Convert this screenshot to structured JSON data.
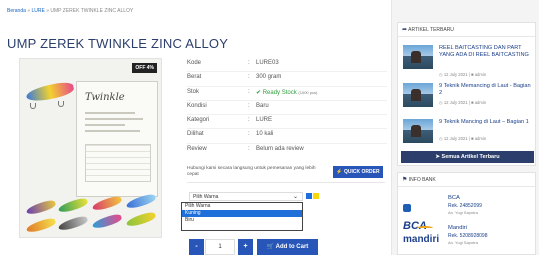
{
  "breadcrumb": {
    "home": "Beranda",
    "sep": " » ",
    "category": "LURE",
    "current": "UMP ZEREK TWINKLE ZINC ALLOY"
  },
  "product": {
    "title": "UMP ZEREK TWINKLE ZINC ALLOY",
    "badge": "OFF 4%",
    "package_title": "Twinkle",
    "specs": [
      {
        "key": "Kode",
        "value": "LURE03"
      },
      {
        "key": "Berat",
        "value": "300 gram"
      },
      {
        "key": "Stok",
        "value": "Ready Stock",
        "note": "(1000 pcs)"
      },
      {
        "key": "Kondisi",
        "value": "Baru"
      },
      {
        "key": "Kategori",
        "value": "LURE"
      },
      {
        "key": "Dilihat",
        "value": "10 kali"
      },
      {
        "key": "Review",
        "value": "Belum ada review"
      }
    ],
    "colon": ":",
    "help_text": "Hubungi kami secara langsung untuk pemesanan yang lebih cepat",
    "quick_order_label": "QUICK ORDER",
    "color_select": {
      "selected": "Pilih Warna",
      "options": [
        "Pilih Warna",
        "Kuning",
        "Biru"
      ],
      "highlighted_index": 1
    },
    "swatches": [
      "#1e6fd9",
      "#f5d90a"
    ],
    "qty": {
      "minus": "-",
      "value": "1",
      "plus": "+"
    },
    "add_to_cart_label": "Add to Cart"
  },
  "sidebar": {
    "articles_header": "ARTIKEL TERBARU",
    "articles": [
      {
        "title": "REEL BAITCASTING DAN PART YANG ADA DI REEL BAITCASTING",
        "date": "12 July 2021",
        "author": "admin"
      },
      {
        "title": "9 Teknik Memancing di Laut - Bagian 2",
        "date": "12 July 2021",
        "author": "admin"
      },
      {
        "title": "9 Teknik Mancing di Laut – Bagian 1",
        "date": "12 July 2021",
        "author": "admin"
      }
    ],
    "all_articles_label": "Semua Artikel Terbaru",
    "bank_header": "INFO BANK",
    "banks": [
      {
        "logo": "BCA",
        "name": "BCA",
        "rek": "Rek. 24852099",
        "an": "An. Yogi Saputra"
      },
      {
        "logo": "mandiri",
        "name": "Mandiri",
        "rek": "Rek. 5208928098",
        "an": "An. Yogi Saputra"
      }
    ]
  },
  "colors": {
    "primary": "#2855b8",
    "navy": "#2c3e6b",
    "stock_green": "#2e9e3d"
  }
}
